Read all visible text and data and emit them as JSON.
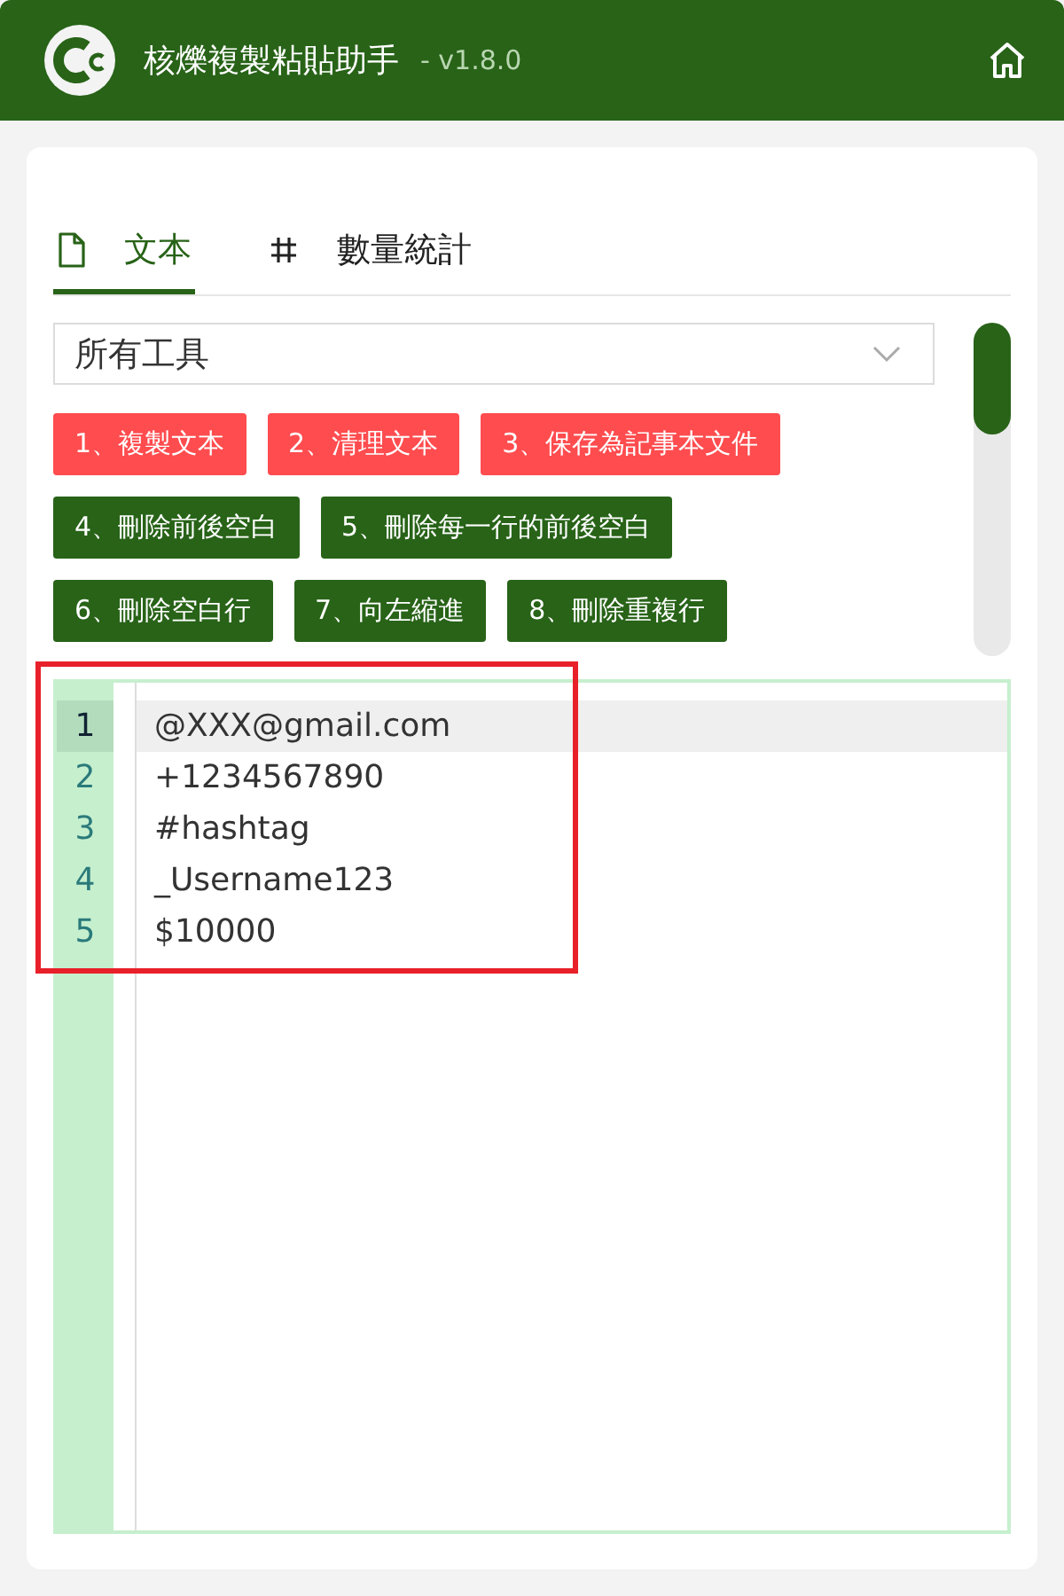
{
  "header": {
    "title": "核爍複製粘貼助手",
    "version": "- v1.8.0"
  },
  "tabs": [
    {
      "label": "文本",
      "selected": true
    },
    {
      "label": "數量統計",
      "selected": false
    }
  ],
  "tool_select": {
    "value": "所有工具"
  },
  "tool_buttons": [
    {
      "label": "1、複製文本",
      "kind": "primary"
    },
    {
      "label": "2、清理文本",
      "kind": "primary"
    },
    {
      "label": "3、保存為記事本文件",
      "kind": "primary"
    },
    {
      "label": "4、刪除前後空白",
      "kind": "normal"
    },
    {
      "label": "5、刪除每一行的前後空白",
      "kind": "normal"
    },
    {
      "label": "6、刪除空白行",
      "kind": "normal"
    },
    {
      "label": "7、向左縮進",
      "kind": "normal"
    },
    {
      "label": "8、刪除重複行",
      "kind": "normal"
    }
  ],
  "editor": {
    "lines": [
      {
        "number": "1",
        "text": "@XXX@gmail.com",
        "active": true
      },
      {
        "number": "2",
        "text": "+1234567890",
        "active": false
      },
      {
        "number": "3",
        "text": "#hashtag",
        "active": false
      },
      {
        "number": "4",
        "text": "_Username123",
        "active": false
      },
      {
        "number": "5",
        "text": "$10000",
        "active": false
      }
    ]
  },
  "annotation": {
    "highlight": true
  }
}
